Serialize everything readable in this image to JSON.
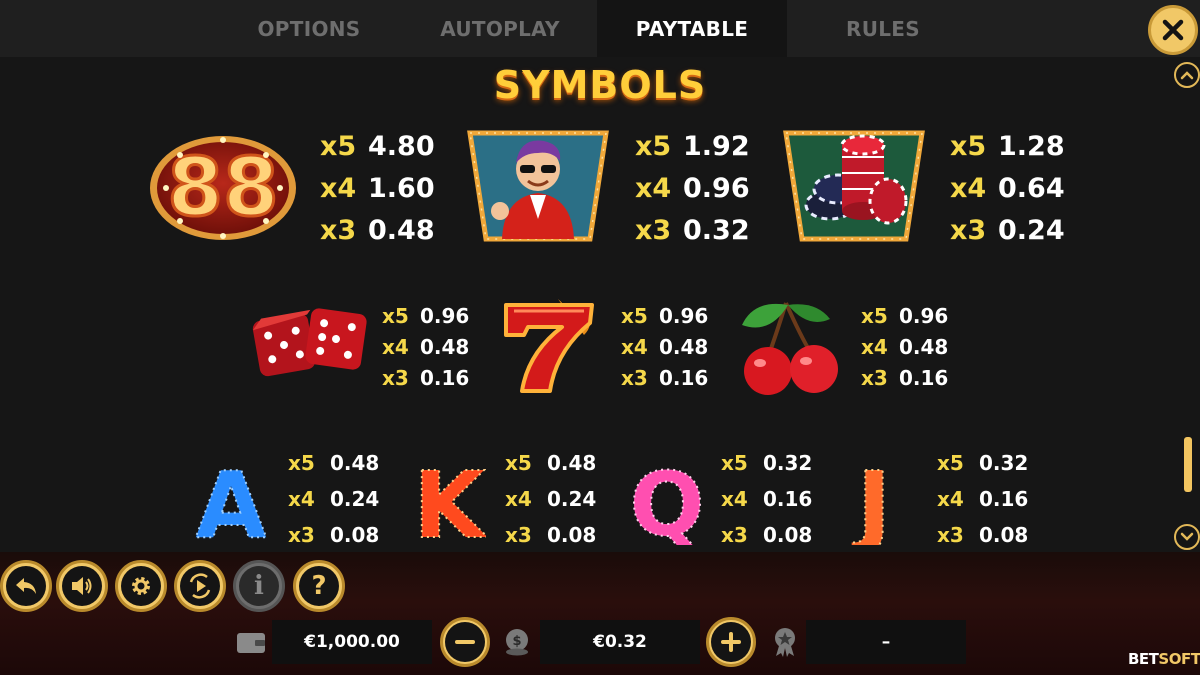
{
  "tabs": [
    {
      "label": "OPTIONS",
      "active": false
    },
    {
      "label": "AUTOPLAY",
      "active": false
    },
    {
      "label": "PAYTABLE",
      "active": true
    },
    {
      "label": "RULES",
      "active": false
    }
  ],
  "section_title": "SYMBOLS",
  "symbols": [
    {
      "name": "88",
      "icon": "88-marquee-icon",
      "pays": [
        {
          "m": "x5",
          "v": "4.80"
        },
        {
          "m": "x4",
          "v": "1.60"
        },
        {
          "m": "x3",
          "v": "0.48"
        }
      ]
    },
    {
      "name": "man",
      "icon": "man-in-red-suit-icon",
      "pays": [
        {
          "m": "x5",
          "v": "1.92"
        },
        {
          "m": "x4",
          "v": "0.96"
        },
        {
          "m": "x3",
          "v": "0.32"
        }
      ]
    },
    {
      "name": "chips",
      "icon": "poker-chips-icon",
      "pays": [
        {
          "m": "x5",
          "v": "1.28"
        },
        {
          "m": "x4",
          "v": "0.64"
        },
        {
          "m": "x3",
          "v": "0.24"
        }
      ]
    },
    {
      "name": "dice",
      "icon": "dice-icon",
      "pays": [
        {
          "m": "x5",
          "v": "0.96"
        },
        {
          "m": "x4",
          "v": "0.48"
        },
        {
          "m": "x3",
          "v": "0.16"
        }
      ]
    },
    {
      "name": "seven",
      "icon": "flaming-seven-icon",
      "pays": [
        {
          "m": "x5",
          "v": "0.96"
        },
        {
          "m": "x4",
          "v": "0.48"
        },
        {
          "m": "x3",
          "v": "0.16"
        }
      ]
    },
    {
      "name": "cherries",
      "icon": "cherries-icon",
      "pays": [
        {
          "m": "x5",
          "v": "0.96"
        },
        {
          "m": "x4",
          "v": "0.48"
        },
        {
          "m": "x3",
          "v": "0.16"
        }
      ]
    },
    {
      "name": "A",
      "icon": "letter-a-icon",
      "letter": "A",
      "color": "#2a8cff",
      "pays": [
        {
          "m": "x5",
          "v": "0.48"
        },
        {
          "m": "x4",
          "v": "0.24"
        },
        {
          "m": "x3",
          "v": "0.08"
        }
      ]
    },
    {
      "name": "K",
      "icon": "letter-k-icon",
      "letter": "K",
      "color": "#ff4a1e",
      "pays": [
        {
          "m": "x5",
          "v": "0.48"
        },
        {
          "m": "x4",
          "v": "0.24"
        },
        {
          "m": "x3",
          "v": "0.08"
        }
      ]
    },
    {
      "name": "Q",
      "icon": "letter-q-icon",
      "letter": "Q",
      "color": "#ff4fb0",
      "pays": [
        {
          "m": "x5",
          "v": "0.32"
        },
        {
          "m": "x4",
          "v": "0.16"
        },
        {
          "m": "x3",
          "v": "0.08"
        }
      ]
    },
    {
      "name": "J",
      "icon": "letter-j-icon",
      "letter": "J",
      "color": "#ff6a2a",
      "pays": [
        {
          "m": "x5",
          "v": "0.32"
        },
        {
          "m": "x4",
          "v": "0.16"
        },
        {
          "m": "x3",
          "v": "0.08"
        }
      ]
    }
  ],
  "scroll_position": 0.85,
  "controls": [
    {
      "icon": "back-arrow-icon"
    },
    {
      "icon": "speaker-icon"
    },
    {
      "icon": "gear-icon"
    },
    {
      "icon": "autoplay-icon"
    },
    {
      "icon": "info-icon"
    },
    {
      "icon": "help-icon",
      "label": "?"
    }
  ],
  "info_label": "i",
  "balance": "€1,000.00",
  "bet": "€0.32",
  "win": "–",
  "brand": {
    "main": "BET",
    "accent": "SOFT"
  },
  "colors": {
    "accent": "#f1c867",
    "multiplier": "#f5d84a",
    "active_tab": "#ffffff",
    "inactive_tab": "#6e6e6e"
  }
}
